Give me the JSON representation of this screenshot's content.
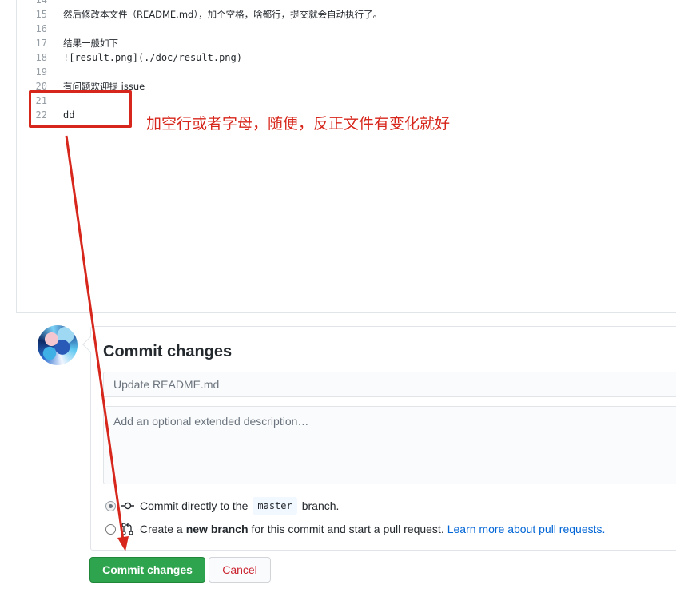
{
  "editor": {
    "lines": [
      {
        "num": "14",
        "text": ""
      },
      {
        "num": "15",
        "text": "然后修改本文件（README.md），加个空格，啥都行，提交就会自动执行了。"
      },
      {
        "num": "16",
        "text": ""
      },
      {
        "num": "17",
        "text": "结果一般如下"
      },
      {
        "num": "18",
        "text_prefix": "!",
        "text_link": "[result.png]",
        "text_suffix": "(./doc/result.png)"
      },
      {
        "num": "19",
        "text": ""
      },
      {
        "num": "20",
        "text": "有问题欢迎提 issue"
      },
      {
        "num": "21",
        "text": ""
      },
      {
        "num": "22",
        "text": "dd"
      }
    ]
  },
  "annotation": {
    "text": "加空行或者字母，随便，反正文件有变化就好",
    "color": "#d7261b"
  },
  "commit": {
    "title": "Commit changes",
    "summary_placeholder": "Update README.md",
    "description_placeholder": "Add an optional extended description…",
    "option_direct": {
      "prefix": "Commit directly to the",
      "branch": "master",
      "suffix": "branch.",
      "checked": true
    },
    "option_new_branch": {
      "prefix": "Create a",
      "bold": "new branch",
      "suffix": "for this commit and start a pull request.",
      "link": "Learn more about pull requests.",
      "checked": false
    },
    "submit_label": "Commit changes",
    "cancel_label": "Cancel"
  },
  "colors": {
    "primary": "#2ea44f",
    "danger": "#cb2431",
    "link": "#0366d6"
  }
}
